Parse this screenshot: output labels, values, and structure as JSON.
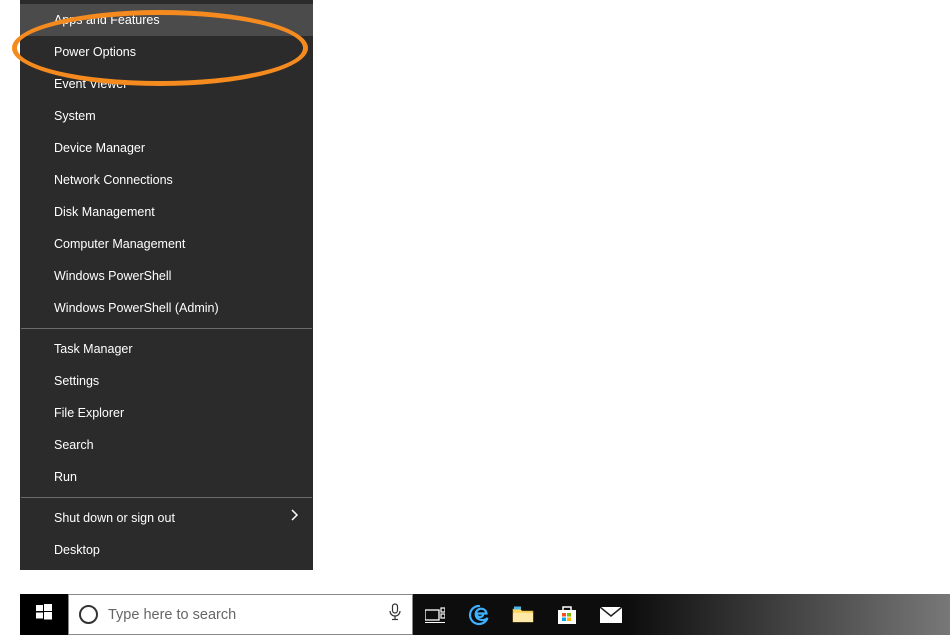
{
  "context_menu": {
    "group1": [
      "Apps and Features",
      "Power Options",
      "Event Viewer",
      "System",
      "Device Manager",
      "Network Connections",
      "Disk Management",
      "Computer Management",
      "Windows PowerShell",
      "Windows PowerShell (Admin)"
    ],
    "group2": [
      "Task Manager",
      "Settings",
      "File Explorer",
      "Search",
      "Run"
    ],
    "group3": [
      {
        "label": "Shut down or sign out",
        "submenu": true
      },
      {
        "label": "Desktop",
        "submenu": false
      }
    ]
  },
  "taskbar": {
    "search_placeholder": "Type here to search"
  },
  "highlight": {
    "target": "Apps and Features",
    "color": "#f58a1f"
  }
}
